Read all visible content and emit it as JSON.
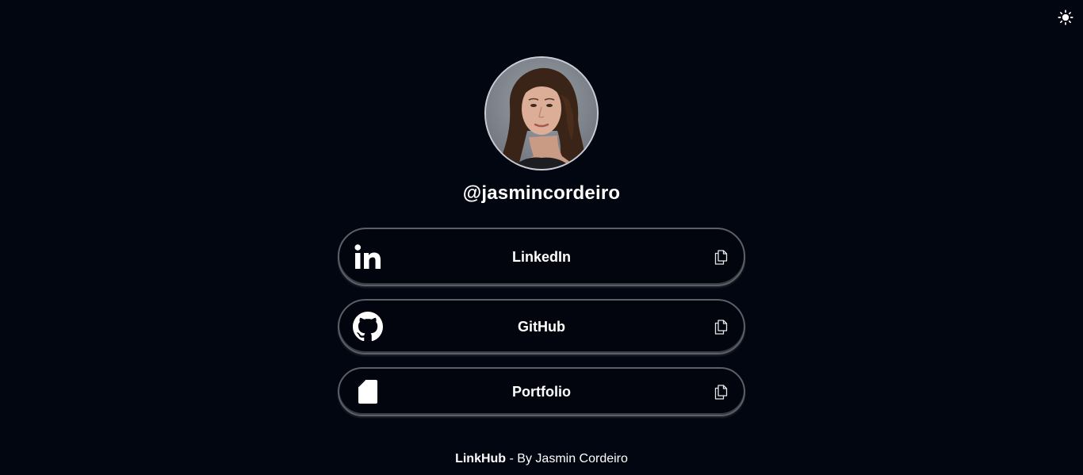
{
  "theme_toggle": {
    "icon": "sun-icon"
  },
  "profile": {
    "handle": "@jasmincordeiro",
    "avatar": "avatar-photo"
  },
  "links": [
    {
      "label": "LinkedIn",
      "icon": "linkedin-icon",
      "action_icon": "copy-icon"
    },
    {
      "label": "GitHub",
      "icon": "github-icon",
      "action_icon": "copy-icon"
    },
    {
      "label": "Portfolio",
      "icon": "document-icon",
      "action_icon": "copy-icon"
    }
  ],
  "footer": {
    "brand": "LinkHub",
    "separator": " - By ",
    "author": "Jasmin Cordeiro"
  },
  "colors": {
    "background": "#020610",
    "text": "#ffffff",
    "border": "#5b5f66"
  }
}
